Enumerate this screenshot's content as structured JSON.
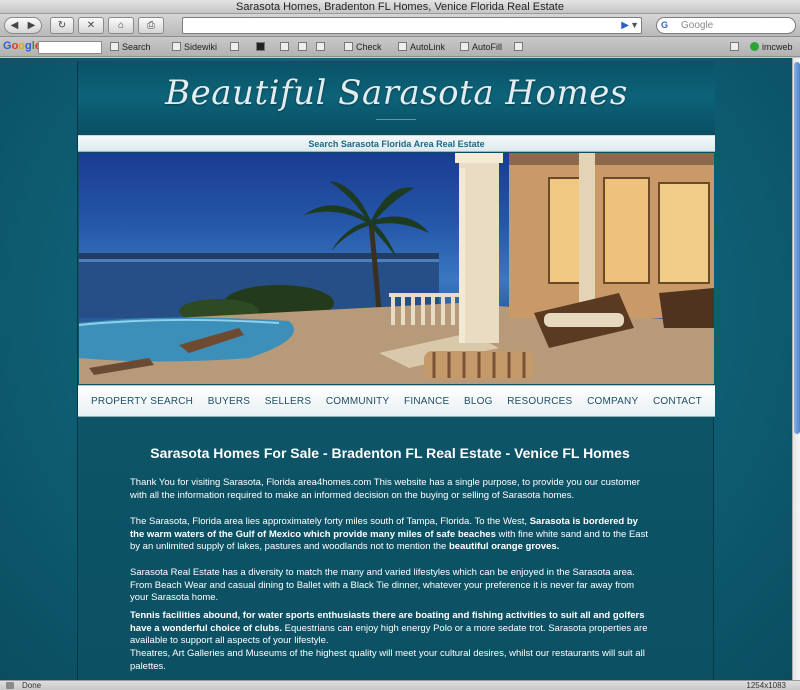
{
  "window": {
    "title": "Sarasota Homes, Bradenton FL Homes, Venice Florida Real Estate"
  },
  "browser": {
    "back_icon": "back-arrow-icon",
    "forward_icon": "forward-arrow-icon",
    "search_placeholder": "Google",
    "search_engine_badge": "G"
  },
  "toolbar": {
    "google_logo": [
      "G",
      "o",
      "o",
      "g",
      "l",
      "e"
    ],
    "items": [
      {
        "label": "Search"
      },
      {
        "label": "Sidewiki"
      },
      {
        "label": "Check"
      },
      {
        "label": "AutoLink"
      },
      {
        "label": "AutoFill"
      },
      {
        "label": "imcweb"
      }
    ]
  },
  "status": {
    "text": "Done",
    "resolution": "1254x1083"
  },
  "site": {
    "logo_text": "Beautiful Sarasota Homes",
    "search_link": "Search Sarasota Florida Area Real Estate",
    "nav": [
      {
        "label": "PROPERTY SEARCH"
      },
      {
        "label": "BUYERS"
      },
      {
        "label": "SELLERS"
      },
      {
        "label": "COMMUNITY"
      },
      {
        "label": "FINANCE"
      },
      {
        "label": "BLOG"
      },
      {
        "label": "RESOURCES"
      },
      {
        "label": "COMPANY"
      },
      {
        "label": "CONTACT"
      }
    ],
    "heading": "Sarasota Homes For Sale - Bradenton FL Real Estate - Venice FL Homes",
    "p1": "Thank You for visiting Sarasota, Florida area4homes.com This website has a single purpose, to provide you our customer with all the information required to make an informed decision on the buying or selling of Sarasota homes.",
    "p2_a": "The Sarasota, Florida area lies approximately forty miles south of Tampa, Florida. To the West, ",
    "p2_b": "Sarasota is bordered by the warm waters of the Gulf of Mexico which provide many miles of safe beaches",
    "p2_c": " with fine white sand and to the East by an unlimited supply of lakes, pastures and woodlands not to mention the ",
    "p2_d": "beautiful orange groves.",
    "p3": "Sarasota Real Estate has a diversity to match the many and varied lifestyles which can be enjoyed in the Sarasota area. From Beach Wear and casual dining to Ballet with a Black Tie dinner, whatever your preference it is never far away from your Sarasota home.",
    "p4_a": "Tennis facilities abound, for water sports enthusiasts there are boating and fishing activities to suit all and golfers have a wonderful choice of clubs.",
    "p4_b": " Equestrians can enjoy high energy Polo or a more sedate trot. Sarasota properties are available to support all aspects of your lifestyle.",
    "p5": "Theatres, Art Galleries and Museums of the highest quality will meet your cultural desires, whilst our restaurants will suit all palettes."
  },
  "colors": {
    "page_bg": "#0f5f74",
    "header_bg": "#0d6379",
    "nav_text": "#1d4f66",
    "search_link": "#1d6a86"
  }
}
